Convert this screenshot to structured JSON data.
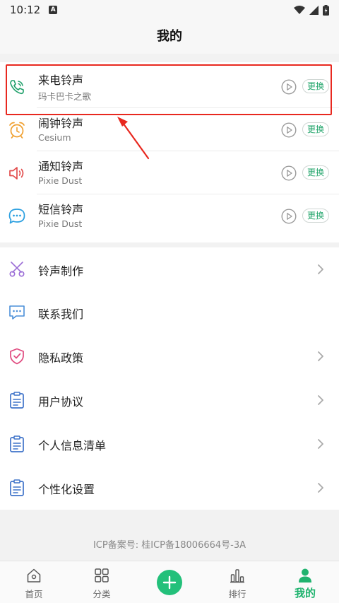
{
  "status_bar": {
    "time": "10:12",
    "notif_icon": "A"
  },
  "header": {
    "title": "我的"
  },
  "ringtones": [
    {
      "title": "来电铃声",
      "subtitle": "玛卡巴卡之歌",
      "icon": "phone-icon",
      "change_label": "更换"
    },
    {
      "title": "闹钟铃声",
      "subtitle": "Cesium",
      "icon": "alarm-clock-icon",
      "change_label": "更换"
    },
    {
      "title": "通知铃声",
      "subtitle": "Pixie Dust",
      "icon": "speaker-icon",
      "change_label": "更换"
    },
    {
      "title": "短信铃声",
      "subtitle": "Pixie Dust",
      "icon": "chat-bubble-icon",
      "change_label": "更换"
    }
  ],
  "menu": [
    {
      "label": "铃声制作",
      "icon": "scissors-icon"
    },
    {
      "label": "联系我们",
      "icon": "message-icon"
    },
    {
      "label": "隐私政策",
      "icon": "shield-icon"
    },
    {
      "label": "用户协议",
      "icon": "clipboard-icon"
    },
    {
      "label": "个人信息清单",
      "icon": "clipboard-icon"
    },
    {
      "label": "个性化设置",
      "icon": "clipboard-icon"
    }
  ],
  "footer": {
    "icp": "ICP备案号: 桂ICP备18006664号-3A"
  },
  "tabbar": [
    {
      "label": "首页",
      "icon": "home-icon"
    },
    {
      "label": "分类",
      "icon": "grid-icon"
    },
    {
      "label": "",
      "icon": "plus-icon"
    },
    {
      "label": "排行",
      "icon": "bar-chart-icon"
    },
    {
      "label": "我的",
      "icon": "person-icon"
    }
  ],
  "colors": {
    "accent": "#1fb36e",
    "highlight": "#e8281f"
  }
}
